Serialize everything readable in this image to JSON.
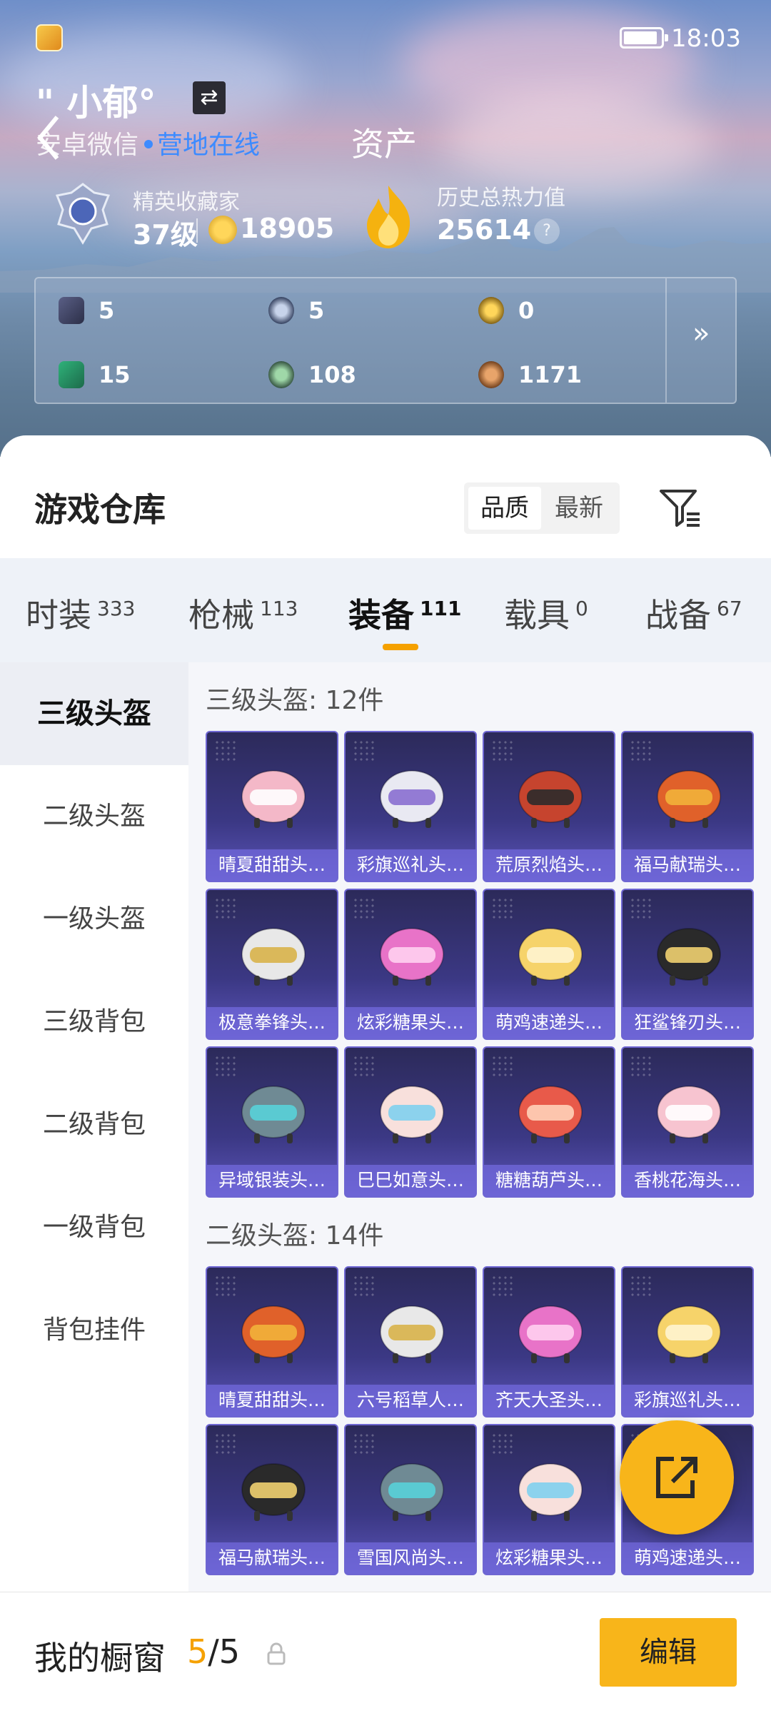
{
  "status": {
    "time": "18:03"
  },
  "profile": {
    "username": "\" 小郁°",
    "platform": "安卓微信",
    "online_status": "营地在线",
    "page_title": "资产"
  },
  "rank": {
    "label": "精英收藏家",
    "level": "37级",
    "coins": "18905"
  },
  "heat": {
    "label": "历史总热力值",
    "value": "25614",
    "help": "?"
  },
  "stats": [
    {
      "icon": "card-icon",
      "value": "5"
    },
    {
      "icon": "silver-badge-icon",
      "value": "5"
    },
    {
      "icon": "gold-badge-icon",
      "value": "0"
    },
    {
      "icon": "ticket-icon",
      "value": "15"
    },
    {
      "icon": "green-coin-icon",
      "value": "108"
    },
    {
      "icon": "bronze-coin-icon",
      "value": "1171"
    }
  ],
  "warehouse": {
    "title": "游戏仓库",
    "sort_options": [
      "品质",
      "最新"
    ],
    "sort_selected": "品质"
  },
  "tabs": [
    {
      "label": "时装",
      "count": "333"
    },
    {
      "label": "枪械",
      "count": "113"
    },
    {
      "label": "装备",
      "count": "111"
    },
    {
      "label": "载具",
      "count": "0"
    },
    {
      "label": "战备",
      "count": "67"
    }
  ],
  "active_tab": "装备",
  "sidebar": [
    "三级头盔",
    "二级头盔",
    "一级头盔",
    "三级背包",
    "二级背包",
    "一级背包",
    "背包挂件"
  ],
  "sections": [
    {
      "label": "三级头盔: 12件",
      "items": [
        "晴夏甜甜头…",
        "彩旗巡礼头…",
        "荒原烈焰头…",
        "福马献瑞头…",
        "极意拳锋头…",
        "炫彩糖果头…",
        "萌鸡速递头…",
        "狂鲨锋刃头…",
        "异域银装头…",
        "巳巳如意头…",
        "糖糖葫芦头…",
        "香桃花海头…"
      ]
    },
    {
      "label": "二级头盔: 14件",
      "items": [
        "晴夏甜甜头…",
        "六号稻草人…",
        "齐天大圣头…",
        "彩旗巡礼头…",
        "福马献瑞头…",
        "雪国风尚头…",
        "炫彩糖果头…",
        "萌鸡速递头…"
      ]
    }
  ],
  "showcase": {
    "label": "我的橱窗",
    "current": "5",
    "total": "/5",
    "edit_label": "编辑"
  },
  "colors": {
    "accent": "#f8b51a",
    "online": "#3d8bff",
    "card": "#3b3884"
  }
}
